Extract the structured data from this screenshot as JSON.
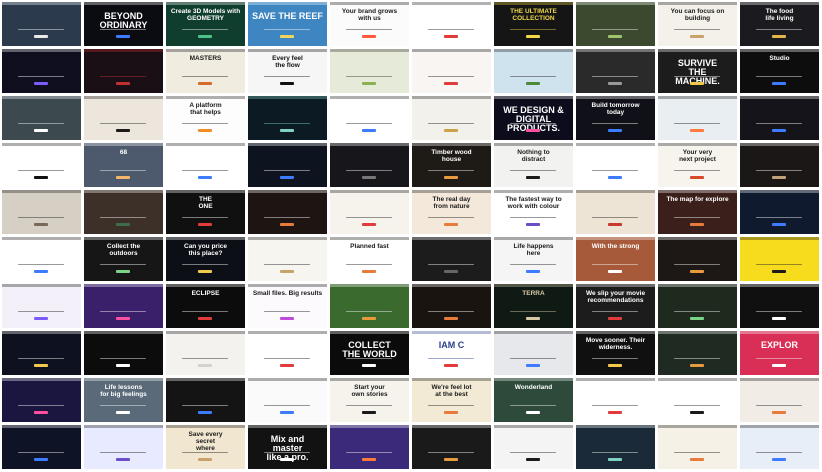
{
  "thumbnails": [
    {
      "bg": "#2c3a4e",
      "fg": "#ffffff",
      "accent": "#e8e8e8",
      "text": ""
    },
    {
      "bg": "#0b0b12",
      "fg": "#ffffff",
      "accent": "#3d7bff",
      "text": "BEYOND\nORDINARY",
      "big": true
    },
    {
      "bg": "#0f3d2e",
      "fg": "#ffffff",
      "accent": "#4cc38a",
      "text": "Create 3D Models with\nGEOMETRY"
    },
    {
      "bg": "#3e86c2",
      "fg": "#ffffff",
      "accent": "#f4d35e",
      "text": "SAVE THE REEF",
      "big": true
    },
    {
      "bg": "#fbfbfb",
      "fg": "#1a1a1a",
      "accent": "#ff5a3c",
      "text": "Your brand grows\nwith us"
    },
    {
      "bg": "#ffffff",
      "fg": "#222222",
      "accent": "#e23b3b",
      "text": ""
    },
    {
      "bg": "#151515",
      "fg": "#f0d84a",
      "accent": "#f0d84a",
      "text": "THE ULTIMATE\nCOLLECTION"
    },
    {
      "bg": "#3b4a2e",
      "fg": "#ffffff",
      "accent": "#9dc46b",
      "text": ""
    },
    {
      "bg": "#f4f1ea",
      "fg": "#1a1a1a",
      "accent": "#c9a26b",
      "text": "You can focus on\nbuilding"
    },
    {
      "bg": "#1b1b1f",
      "fg": "#ffffff",
      "accent": "#e4b44d",
      "text": "The food\nlife living"
    },
    {
      "bg": "#0f0f1f",
      "fg": "#ffffff",
      "accent": "#7c5cff",
      "text": ""
    },
    {
      "bg": "#1a0f14",
      "fg": "#c03030",
      "accent": "#c03030",
      "text": ""
    },
    {
      "bg": "#f1ece0",
      "fg": "#1a1a1a",
      "accent": "#d86a2b",
      "text": "MASTERS"
    },
    {
      "bg": "#f6f6f6",
      "fg": "#111111",
      "accent": "#111111",
      "text": "Every feel\nthe flow"
    },
    {
      "bg": "#e6ead8",
      "fg": "#333333",
      "accent": "#8bb04f",
      "text": ""
    },
    {
      "bg": "#f8f5f2",
      "fg": "#1a1a1a",
      "accent": "#e23b3b",
      "text": ""
    },
    {
      "bg": "#cfe3ee",
      "fg": "#1a1a1a",
      "accent": "#4c8a3a",
      "text": ""
    },
    {
      "bg": "#2a2a2a",
      "fg": "#ffffff",
      "accent": "#999999",
      "text": ""
    },
    {
      "bg": "#1c1c1c",
      "fg": "#ffffff",
      "accent": "#f2c94c",
      "text": "SURVIVE\nTHE\nMACHINE.",
      "big": true
    },
    {
      "bg": "#0d0d0d",
      "fg": "#ffffff",
      "accent": "#3d7bff",
      "text": "Studio"
    },
    {
      "bg": "#3c4a50",
      "fg": "#ffffff",
      "accent": "#ffffff",
      "text": ""
    },
    {
      "bg": "#ede6dc",
      "fg": "#1a1a1a",
      "accent": "#1a1a1a",
      "text": ""
    },
    {
      "bg": "#fdfdfd",
      "fg": "#1a1a1a",
      "accent": "#f28c28",
      "text": "A platform\nthat helps"
    },
    {
      "bg": "#0c1a24",
      "fg": "#7fd1c1",
      "accent": "#7fd1c1",
      "text": ""
    },
    {
      "bg": "#ffffff",
      "fg": "#1a1a1a",
      "accent": "#3d7bff",
      "text": ""
    },
    {
      "bg": "#f3f1ec",
      "fg": "#1a1a1a",
      "accent": "#c9a24a",
      "text": ""
    },
    {
      "bg": "#0c0c1c",
      "fg": "#ffffff",
      "accent": "#ff4fa0",
      "text": "WE DESIGN &\nDIGITAL\nPRODUCTS.",
      "big": true
    },
    {
      "bg": "#101018",
      "fg": "#ffffff",
      "accent": "#3d7bff",
      "text": "Build tomorrow\ntoday"
    },
    {
      "bg": "#e9eef3",
      "fg": "#1a1a1a",
      "accent": "#ff7a3c",
      "text": ""
    },
    {
      "bg": "#14141a",
      "fg": "#ffffff",
      "accent": "#3d7bff",
      "text": ""
    },
    {
      "bg": "#ffffff",
      "fg": "#1a1a1a",
      "accent": "#111111",
      "text": ""
    },
    {
      "bg": "#4d5a6e",
      "fg": "#ffffff",
      "accent": "#f3b66b",
      "text": "68"
    },
    {
      "bg": "#ffffff",
      "fg": "#1a1a1a",
      "accent": "#3d7bff",
      "text": ""
    },
    {
      "bg": "#0d1420",
      "fg": "#ffffff",
      "accent": "#3d7bff",
      "text": ""
    },
    {
      "bg": "#17171b",
      "fg": "#ffffff",
      "accent": "#777777",
      "text": ""
    },
    {
      "bg": "#1e1a16",
      "fg": "#ffffff",
      "accent": "#e89b3c",
      "text": "Timber wood\nhouse"
    },
    {
      "bg": "#f2f2f0",
      "fg": "#1a1a1a",
      "accent": "#1a1a1a",
      "text": "Nothing to\ndistract"
    },
    {
      "bg": "#ffffff",
      "fg": "#1a1a1a",
      "accent": "#3d7bff",
      "text": ""
    },
    {
      "bg": "#f7f4ee",
      "fg": "#1a1a1a",
      "accent": "#d64a2b",
      "text": "Your very\nnext project"
    },
    {
      "bg": "#1a1716",
      "fg": "#ffffff",
      "accent": "#c0a27a",
      "text": ""
    },
    {
      "bg": "#d6cfc4",
      "fg": "#1a1a1a",
      "accent": "#7a6a55",
      "text": ""
    },
    {
      "bg": "#3c3028",
      "fg": "#ffffff",
      "accent": "#3c6e4a",
      "text": ""
    },
    {
      "bg": "#101010",
      "fg": "#ffffff",
      "accent": "#e23b3b",
      "text": "THE\nONE"
    },
    {
      "bg": "#1e1512",
      "fg": "#ffffff",
      "accent": "#e87a3c",
      "text": ""
    },
    {
      "bg": "#f6f2ec",
      "fg": "#1a1a1a",
      "accent": "#e23b3b",
      "text": ""
    },
    {
      "bg": "#f3e8da",
      "fg": "#1a1a1a",
      "accent": "#e87a3c",
      "text": "The real day\nfrom nature"
    },
    {
      "bg": "#ffffff",
      "fg": "#1a1a1a",
      "accent": "#6b4ec7",
      "text": "The fastest way to\nwork with colour"
    },
    {
      "bg": "#ede4d6",
      "fg": "#1a1a1a",
      "accent": "#c43a2b",
      "text": ""
    },
    {
      "bg": "#3a1f1a",
      "fg": "#ffffff",
      "accent": "#e87a3c",
      "text": "The map for explore"
    },
    {
      "bg": "#0f1a2e",
      "fg": "#ffffff",
      "accent": "#3d7bff",
      "text": ""
    },
    {
      "bg": "#ffffff",
      "fg": "#1a1a1a",
      "accent": "#3d7bff",
      "text": ""
    },
    {
      "bg": "#161616",
      "fg": "#ffffff",
      "accent": "#7bd389",
      "text": "Collect the\noutdoors"
    },
    {
      "bg": "#0c0f16",
      "fg": "#ffffff",
      "accent": "#f2c94c",
      "text": "Can you price\nthis place?"
    },
    {
      "bg": "#f7f5f0",
      "fg": "#1a1a1a",
      "accent": "#c9a26b",
      "text": ""
    },
    {
      "bg": "#ffffff",
      "fg": "#1a1a1a",
      "accent": "#e87a3c",
      "text": "Planned fast"
    },
    {
      "bg": "#1c1c1c",
      "fg": "#ffffff",
      "accent": "#666666",
      "text": ""
    },
    {
      "bg": "#f5f5f5",
      "fg": "#1a1a1a",
      "accent": "#3d7bff",
      "text": "Life happens\nhere"
    },
    {
      "bg": "#a65a3a",
      "fg": "#ffffff",
      "accent": "#ffffff",
      "text": "With the strong"
    },
    {
      "bg": "#1d1816",
      "fg": "#ffffff",
      "accent": "#e89b3c",
      "text": ""
    },
    {
      "bg": "#f7dc1e",
      "fg": "#1a1a1a",
      "accent": "#1a1a1a",
      "text": ""
    },
    {
      "bg": "#f3f0fa",
      "fg": "#1a1a1a",
      "accent": "#7c5cff",
      "text": ""
    },
    {
      "bg": "#3a1f6a",
      "fg": "#ffffff",
      "accent": "#ff4fa0",
      "text": ""
    },
    {
      "bg": "#0c0c0c",
      "fg": "#ffffff",
      "accent": "#e23b3b",
      "text": "ECLIPSE"
    },
    {
      "bg": "#fcfafc",
      "fg": "#1a1a1a",
      "accent": "#c04adb",
      "text": "Small files. Big results"
    },
    {
      "bg": "#3b6a2e",
      "fg": "#ffffff",
      "accent": "#e89b3c",
      "text": ""
    },
    {
      "bg": "#1a1410",
      "fg": "#ffffff",
      "accent": "#e87a3c",
      "text": ""
    },
    {
      "bg": "#0f1a14",
      "fg": "#d8c9a6",
      "accent": "#d8c9a6",
      "text": "TERRA"
    },
    {
      "bg": "#1c1c1c",
      "fg": "#ffffff",
      "accent": "#e23b3b",
      "text": "We slip your movie\nrecommendations"
    },
    {
      "bg": "#1e2a1e",
      "fg": "#ffffff",
      "accent": "#7bd389",
      "text": ""
    },
    {
      "bg": "#101010",
      "fg": "#ffffff",
      "accent": "#ffffff",
      "text": ""
    },
    {
      "bg": "#0e1220",
      "fg": "#ffffff",
      "accent": "#f2c94c",
      "text": ""
    },
    {
      "bg": "#0c0c0c",
      "fg": "#ffffff",
      "accent": "#ffffff",
      "text": ""
    },
    {
      "bg": "#f4f2ee",
      "fg": "#1a1a1a",
      "accent": "#d6d2cb",
      "text": ""
    },
    {
      "bg": "#ffffff",
      "fg": "#1a1a1a",
      "accent": "#e23b3b",
      "text": ""
    },
    {
      "bg": "#0b0b0b",
      "fg": "#ffffff",
      "accent": "#ffffff",
      "text": "COLLECT\nTHE WORLD",
      "big": true
    },
    {
      "bg": "#ffffff",
      "fg": "#2a3f8a",
      "accent": "#e23b3b",
      "text": "IAM  C",
      "big": true
    },
    {
      "bg": "#e6e8ec",
      "fg": "#1a1a1a",
      "accent": "#3d7bff",
      "text": ""
    },
    {
      "bg": "#101010",
      "fg": "#ffffff",
      "accent": "#f2c94c",
      "text": "Move sooner. Their\nwiderness."
    },
    {
      "bg": "#1e2a22",
      "fg": "#ffffff",
      "accent": "#e89b3c",
      "text": ""
    },
    {
      "bg": "#d92e55",
      "fg": "#ffffff",
      "accent": "#ffffff",
      "text": "EXPLOR",
      "big": true
    },
    {
      "bg": "#1a1640",
      "fg": "#ffffff",
      "accent": "#ff4fa0",
      "text": ""
    },
    {
      "bg": "#5a6a78",
      "fg": "#ffffff",
      "accent": "#ffffff",
      "text": "Life lessons\nfor big feelings"
    },
    {
      "bg": "#141414",
      "fg": "#ffffff",
      "accent": "#3d7bff",
      "text": ""
    },
    {
      "bg": "#fafafa",
      "fg": "#1a1a1a",
      "accent": "#3d7bff",
      "text": ""
    },
    {
      "bg": "#f6f3ec",
      "fg": "#1a1a1a",
      "accent": "#1a1a1a",
      "text": "Start your\nown stories"
    },
    {
      "bg": "#f2ead4",
      "fg": "#1a1a1a",
      "accent": "#e87a3c",
      "text": "We're feel lot\nat the best"
    },
    {
      "bg": "#2e4a3a",
      "fg": "#ffffff",
      "accent": "#ffffff",
      "text": "Wonderland"
    },
    {
      "bg": "#ffffff",
      "fg": "#1a1a1a",
      "accent": "#e23b3b",
      "text": ""
    },
    {
      "bg": "#ffffff",
      "fg": "#1a1a1a",
      "accent": "#1a1a1a",
      "text": ""
    },
    {
      "bg": "#f1ede6",
      "fg": "#1a1a1a",
      "accent": "#e87a3c",
      "text": ""
    },
    {
      "bg": "#0e1326",
      "fg": "#ffffff",
      "accent": "#3d7bff",
      "text": ""
    },
    {
      "bg": "#e8eaff",
      "fg": "#1a1a1a",
      "accent": "#6b4ec7",
      "text": ""
    },
    {
      "bg": "#f1e6cf",
      "fg": "#1a1a1a",
      "accent": "#c9a26b",
      "text": "Save every\nsecret\nwhere"
    },
    {
      "bg": "#121212",
      "fg": "#ffffff",
      "accent": "#ffffff",
      "text": "Mix and\nmaster\nlike a pro.",
      "big": true
    },
    {
      "bg": "#3b2a7a",
      "fg": "#ffffff",
      "accent": "#ff7a3c",
      "text": ""
    },
    {
      "bg": "#1a1a1a",
      "fg": "#ffffff",
      "accent": "#e89b3c",
      "text": ""
    },
    {
      "bg": "#f4f4f4",
      "fg": "#1a1a1a",
      "accent": "#1a1a1a",
      "text": ""
    },
    {
      "bg": "#1a2a38",
      "fg": "#ffffff",
      "accent": "#7fd1c1",
      "text": ""
    },
    {
      "bg": "#f6f1e6",
      "fg": "#1a1a1a",
      "accent": "#e87a3c",
      "text": ""
    },
    {
      "bg": "#e7eef8",
      "fg": "#1a1a1a",
      "accent": "#3d7bff",
      "text": ""
    }
  ]
}
